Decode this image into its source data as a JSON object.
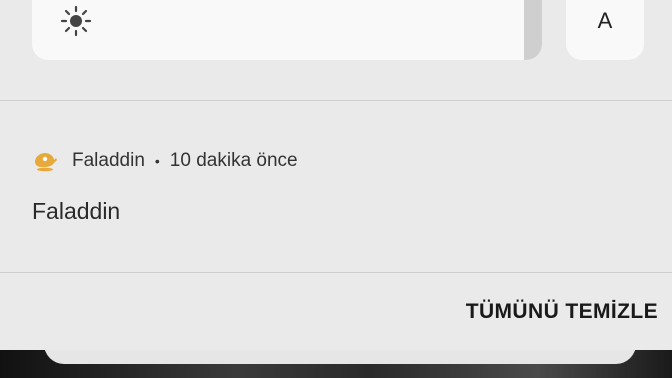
{
  "quick_panel": {
    "brightness": {
      "icon": "sun-icon"
    },
    "auto_button_label": "A"
  },
  "notification": {
    "app_icon": "lamp-icon",
    "app_name": "Faladdin",
    "separator": "•",
    "time": "10 dakika önce",
    "title": "Faladdin"
  },
  "actions": {
    "clear_all_label": "TÜMÜNÜ TEMİZLE"
  },
  "colors": {
    "accent_icon": "#e8a93b",
    "panel_bg": "#eaeaea",
    "card_bg": "#f9f9f9"
  }
}
